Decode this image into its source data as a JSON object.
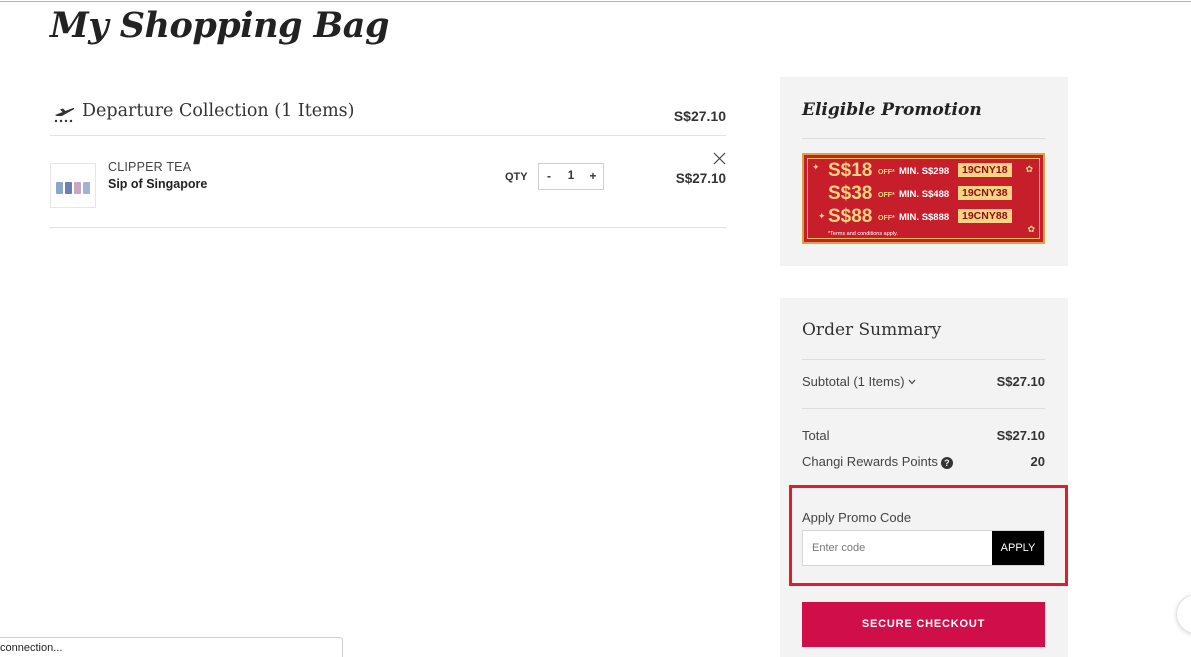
{
  "page": {
    "title": "My Shopping Bag"
  },
  "collection": {
    "title": "Departure Collection (1 Items)",
    "total": "S$27.10",
    "icon": "plane-departure-icon"
  },
  "item": {
    "brand": "CLIPPER TEA",
    "name": "Sip of Singapore",
    "qty_label": "QTY",
    "qty_minus": "-",
    "qty_value": "1",
    "qty_plus": "+",
    "price": "S$27.10"
  },
  "promotion": {
    "title": "Eligible Promotion",
    "lines": [
      {
        "amount": "S$18",
        "off": "OFF*",
        "min": "MIN. S$298",
        "code": "19CNY18"
      },
      {
        "amount": "S$38",
        "off": "OFF*",
        "min": "MIN. S$488",
        "code": "19CNY38"
      },
      {
        "amount": "S$88",
        "off": "OFF*",
        "min": "MIN. S$888",
        "code": "19CNY88"
      }
    ],
    "terms": "*Terms and conditions apply.",
    "colors": {
      "background": "#c61f2b",
      "gold": "#f5d483"
    }
  },
  "summary": {
    "title": "Order Summary",
    "subtotal_label": "Subtotal (1 Items)",
    "subtotal_value": "S$27.10",
    "total_label": "Total",
    "total_value": "S$27.10",
    "rewards_label": "Changi Rewards Points",
    "rewards_value": "20",
    "promo_label": "Apply Promo Code",
    "promo_placeholder": "Enter code",
    "apply_label": "APPLY",
    "checkout_label": "SECURE CHECKOUT",
    "colors": {
      "checkout": "#cf0e4a",
      "highlight": "#e11d2c"
    }
  },
  "status": {
    "text": "connection..."
  }
}
